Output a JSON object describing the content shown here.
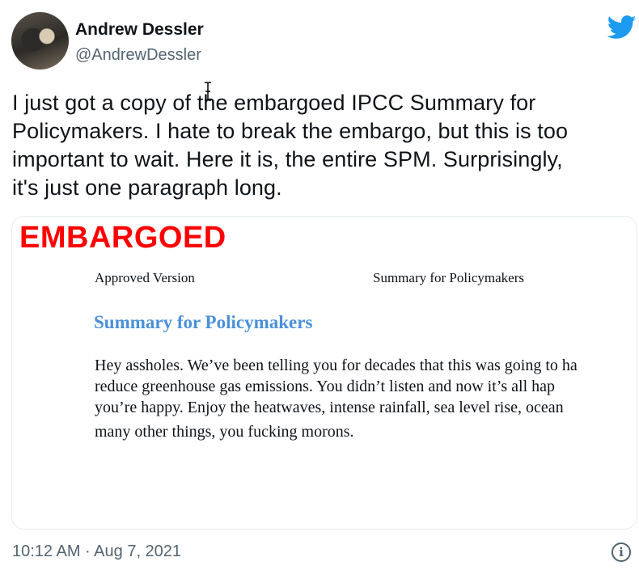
{
  "author": {
    "name": "Andrew Dessler",
    "handle": "@AndrewDessler"
  },
  "tweet": {
    "text": "I just got a copy of the embargoed IPCC Summary for\nPolicymakers.  I hate to break the embargo, but this is too\nimportant to wait.  Here it is, the entire SPM.  Surprisingly,\nit's just one paragraph long.",
    "timestamp": "10:12 AM · Aug 7, 2021"
  },
  "media": {
    "stamp": "EMBARGOED",
    "doc_header_left": "Approved Version",
    "doc_header_right": "Summary for Policymakers",
    "doc_title": "Summary for Policymakers",
    "doc_lines": [
      "Hey assholes. We’ve been telling you for decades that this was going to ha",
      "reduce greenhouse gas emissions. You didn’t listen and now it’s all hap",
      "you’re happy. Enjoy the heatwaves, intense rainfall, sea level rise, ocean",
      "many other things, you fucking morons."
    ]
  },
  "icons": {
    "brand": "twitter-bird-icon",
    "info": "info-icon",
    "cursor": "text-cursor-icon"
  },
  "colors": {
    "brand": "#1d9bf0",
    "stamp": "#ff0000",
    "doc_title": "#4a90d9",
    "secondary_text": "#536471"
  }
}
